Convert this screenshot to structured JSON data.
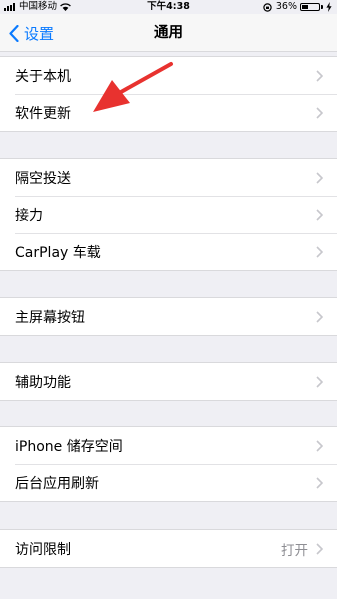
{
  "status_bar": {
    "carrier": "中国移动",
    "time": "下午4:38",
    "battery": "36%",
    "battery_level": 0.36
  },
  "nav": {
    "back_label": "设置",
    "title": "通用"
  },
  "groups": [
    {
      "items": [
        {
          "label": "关于本机"
        },
        {
          "label": "软件更新"
        }
      ]
    },
    {
      "items": [
        {
          "label": "隔空投送"
        },
        {
          "label": "接力"
        },
        {
          "label": "CarPlay 车载"
        }
      ]
    },
    {
      "items": [
        {
          "label": "主屏幕按钮"
        }
      ]
    },
    {
      "items": [
        {
          "label": "辅助功能"
        }
      ]
    },
    {
      "items": [
        {
          "label": "iPhone 储存空间"
        },
        {
          "label": "后台应用刷新"
        }
      ]
    },
    {
      "items": [
        {
          "label": "访问限制",
          "value": "打开"
        }
      ]
    }
  ],
  "colors": {
    "accent": "#0a7aff",
    "annotation_arrow": "#e8322f",
    "background": "#efeff4"
  }
}
